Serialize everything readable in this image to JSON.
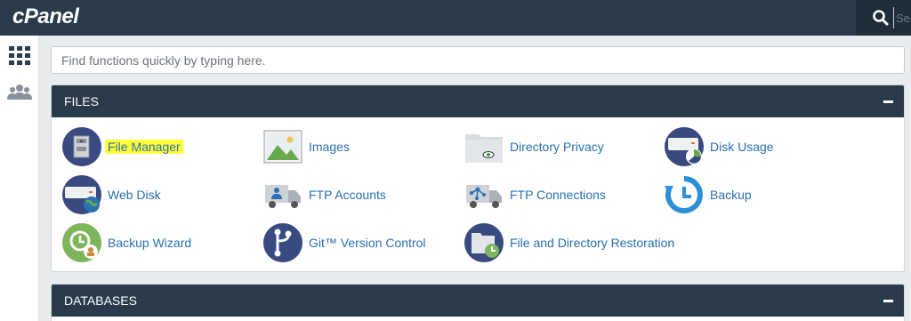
{
  "brand": {
    "logo": "cPanel"
  },
  "topbar": {
    "search_placeholder": "Search"
  },
  "quick_search": {
    "placeholder": "Find functions quickly by typing here."
  },
  "sections": {
    "files": {
      "title": "FILES",
      "items": [
        {
          "label": "File Manager",
          "icon": "file-manager-icon"
        },
        {
          "label": "Images",
          "icon": "images-icon"
        },
        {
          "label": "Directory Privacy",
          "icon": "directory-privacy-icon"
        },
        {
          "label": "Disk Usage",
          "icon": "disk-usage-icon"
        },
        {
          "label": "Web Disk",
          "icon": "web-disk-icon"
        },
        {
          "label": "FTP Accounts",
          "icon": "ftp-accounts-icon"
        },
        {
          "label": "FTP Connections",
          "icon": "ftp-connections-icon"
        },
        {
          "label": "Backup",
          "icon": "backup-icon"
        },
        {
          "label": "Backup Wizard",
          "icon": "backup-wizard-icon"
        },
        {
          "label": "Git™ Version Control",
          "icon": "git-icon"
        },
        {
          "label": "File and Directory Restoration",
          "icon": "restore-icon"
        }
      ]
    },
    "databases": {
      "title": "DATABASES"
    }
  },
  "colors": {
    "header": "#293a4a",
    "link": "#2a6fb0",
    "highlight": "#ffff38",
    "icon_navy": "#384a80"
  }
}
